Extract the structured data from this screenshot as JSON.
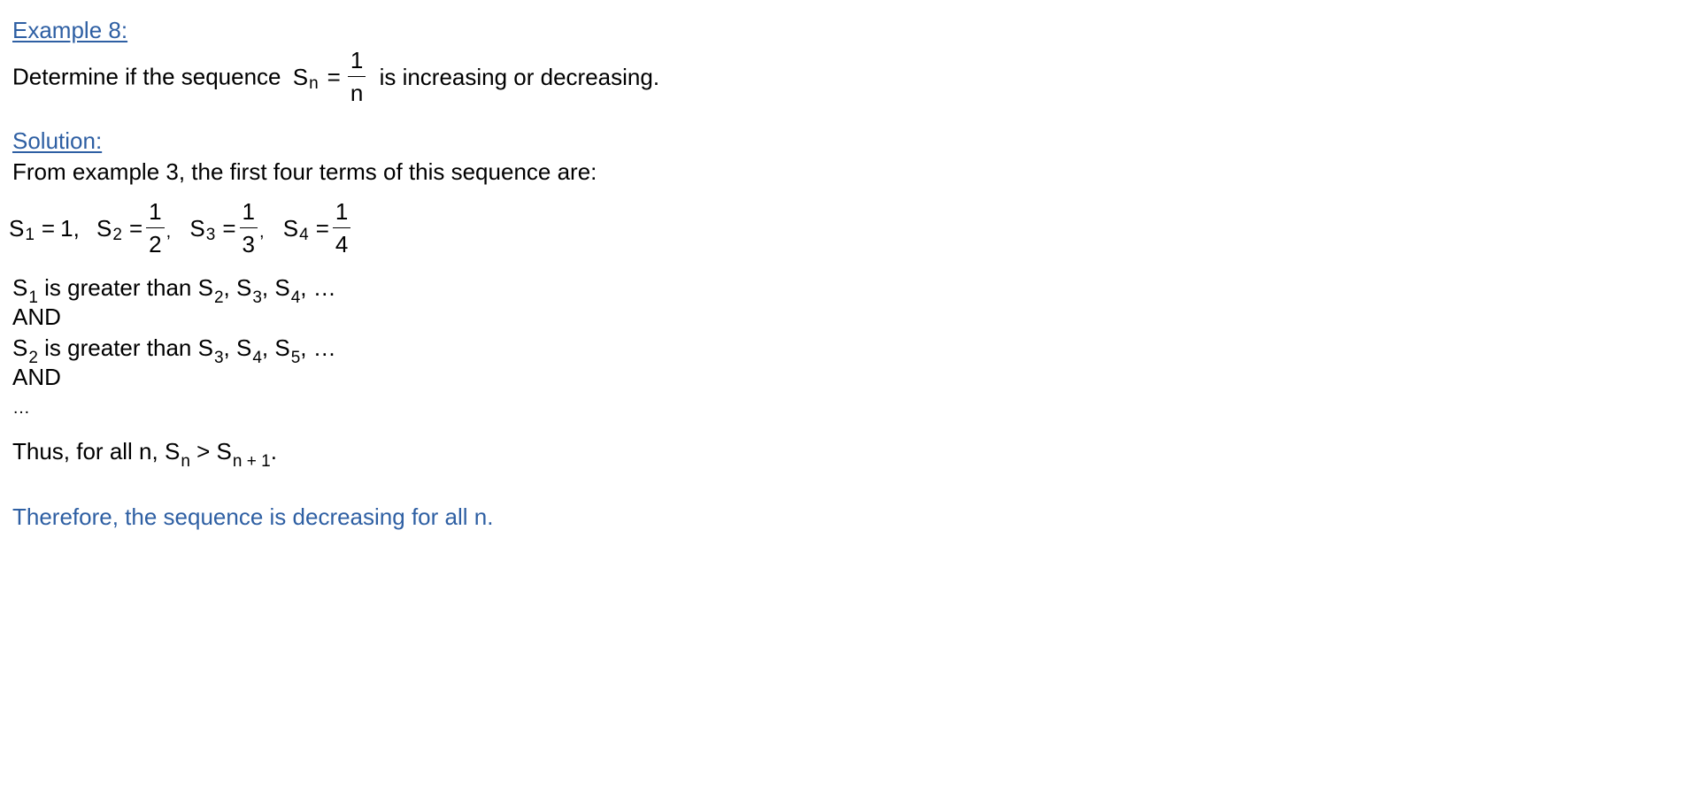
{
  "example": {
    "heading": "Example 8:",
    "problem_prefix": "Determine if the sequence",
    "seq_symbol": "S",
    "seq_index": "n",
    "equals": "=",
    "frac_num": "1",
    "frac_den": "n",
    "problem_suffix": "is increasing or decreasing."
  },
  "solution": {
    "heading": "Solution:",
    "intro": "From example 3, the first four terms of this sequence are:",
    "terms": [
      {
        "symbol": "S",
        "index": "1",
        "eq": "=",
        "value": "1",
        "sep": ","
      },
      {
        "symbol": "S",
        "index": "2",
        "eq": "=",
        "num": "1",
        "den": "2",
        "sep": ","
      },
      {
        "symbol": "S",
        "index": "3",
        "eq": "=",
        "num": "1",
        "den": "3",
        "sep": ","
      },
      {
        "symbol": "S",
        "index": "4",
        "eq": "=",
        "num": "1",
        "den": "4",
        "sep": ""
      }
    ],
    "compare1": {
      "lead_index": "1",
      "text": "is greater than",
      "indices": [
        "2",
        "3",
        "4"
      ],
      "tail": "…"
    },
    "and1": "AND",
    "compare2": {
      "lead_index": "2",
      "text": "is greater than",
      "indices": [
        "3",
        "4",
        "5"
      ],
      "tail": "…"
    },
    "and2": "AND",
    "ellipsis": "…",
    "thus": {
      "prefix": "Thus, for all n,",
      "left_index": "n",
      "op": ">",
      "right_index": "n + 1",
      "end": "."
    },
    "conclusion": "Therefore, the sequence is decreasing for all n."
  }
}
